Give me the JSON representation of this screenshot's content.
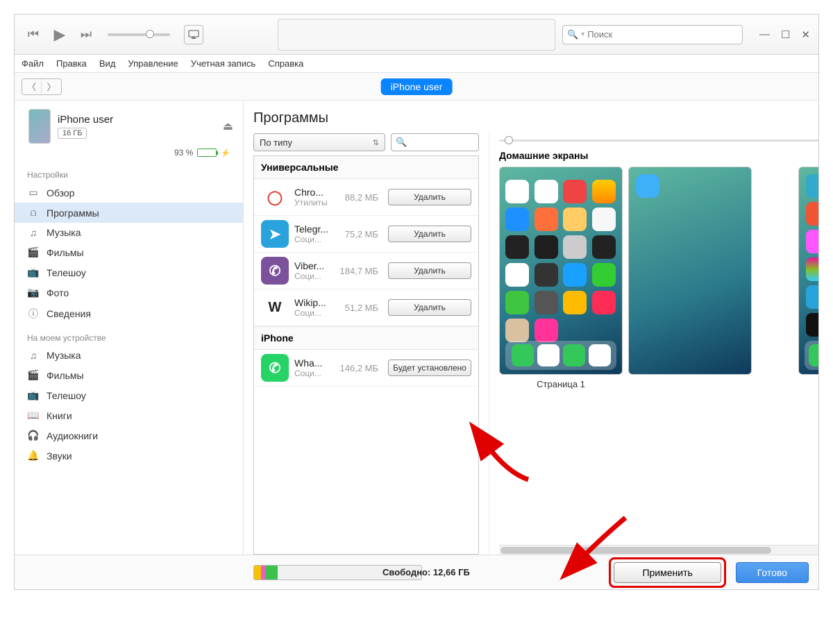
{
  "titlebar": {
    "search_placeholder": "Поиск"
  },
  "menubar": {
    "file": "Файл",
    "edit": "Правка",
    "view": "Вид",
    "controls": "Управление",
    "account": "Учетная запись",
    "help": "Справка"
  },
  "device_pill": "iPhone user",
  "device": {
    "name": "iPhone user",
    "capacity": "16 ГБ",
    "battery_pct": "93 %"
  },
  "sidebar": {
    "settings_label": "Настройки",
    "on_device_label": "На моем устройстве",
    "settings": [
      {
        "label": "Обзор",
        "icon": "▭"
      },
      {
        "label": "Программы",
        "icon": "⩍"
      },
      {
        "label": "Музыка",
        "icon": "♫"
      },
      {
        "label": "Фильмы",
        "icon": "🎬"
      },
      {
        "label": "Телешоу",
        "icon": "📺"
      },
      {
        "label": "Фото",
        "icon": "📷"
      },
      {
        "label": "Сведения",
        "icon": "ⓘ"
      }
    ],
    "on_device": [
      {
        "label": "Музыка",
        "icon": "♫"
      },
      {
        "label": "Фильмы",
        "icon": "🎬"
      },
      {
        "label": "Телешоу",
        "icon": "📺"
      },
      {
        "label": "Книги",
        "icon": "📖"
      },
      {
        "label": "Аудиокниги",
        "icon": "🎧"
      },
      {
        "label": "Звуки",
        "icon": "🔔"
      }
    ]
  },
  "content": {
    "title": "Программы",
    "sort_label": "По типу",
    "group_universal": "Универсальные",
    "group_iphone": "iPhone",
    "btn_remove": "Удалить",
    "btn_will_install": "Будет установлено",
    "apps_universal": [
      {
        "name": "Chro...",
        "cat": "Утилиты",
        "size": "88,2 МБ",
        "color": "#fff",
        "fg": "#E34133",
        "glyph": "◯"
      },
      {
        "name": "Telegr...",
        "cat": "Соци...",
        "size": "75,2 МБ",
        "color": "#2AA3DC",
        "glyph": "➤"
      },
      {
        "name": "Viber...",
        "cat": "Соци...",
        "size": "184,7 МБ",
        "color": "#7B519C",
        "glyph": "✆"
      },
      {
        "name": "Wikip...",
        "cat": "Соци...",
        "size": "51,2 МБ",
        "color": "#fff",
        "fg": "#222",
        "glyph": "W"
      }
    ],
    "apps_iphone": [
      {
        "name": "Wha...",
        "cat": "Соци...",
        "size": "146,2 МБ",
        "color": "#25D366",
        "glyph": "✆"
      }
    ]
  },
  "home": {
    "label": "Домашние экраны",
    "page1": "Страница 1"
  },
  "footer": {
    "free_label": "Свободно: 12,66 ГБ",
    "apply": "Применить",
    "done": "Готово",
    "segments": [
      {
        "color": "#f6c100",
        "w": "4%"
      },
      {
        "color": "#e85fbf",
        "w": "3%"
      },
      {
        "color": "#3cc24a",
        "w": "7%"
      },
      {
        "color": "#f0f0f0",
        "w": "86%"
      }
    ]
  }
}
